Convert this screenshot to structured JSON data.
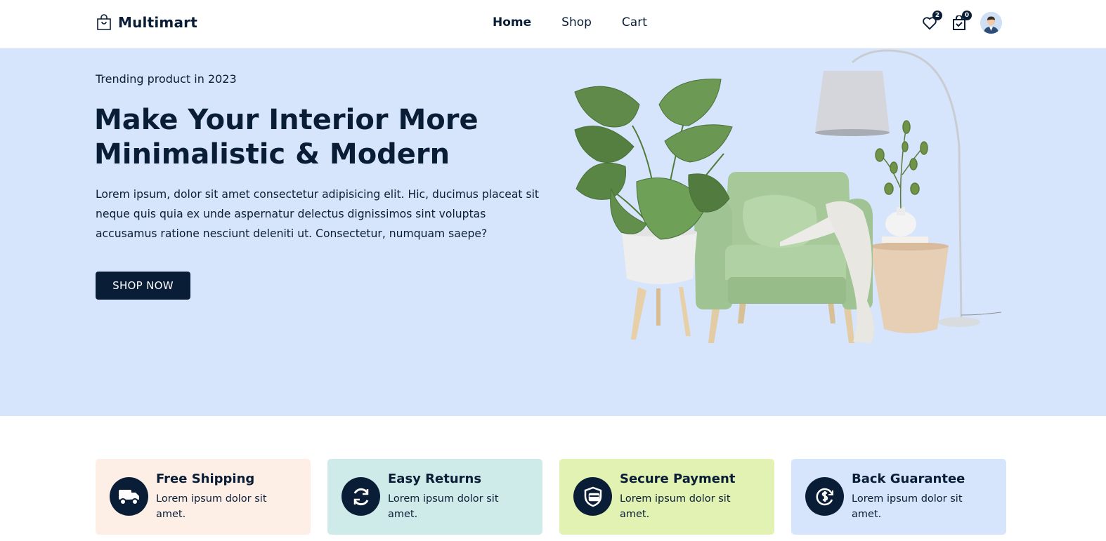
{
  "header": {
    "brand": "Multimart",
    "nav": [
      {
        "label": "Home",
        "active": true
      },
      {
        "label": "Shop",
        "active": false
      },
      {
        "label": "Cart",
        "active": false
      }
    ],
    "wishlist_count": "2",
    "cart_count": "0",
    "icons": {
      "logo": "shopping-bag-icon",
      "wishlist": "heart-icon",
      "cart": "shopping-bag-icon"
    }
  },
  "hero": {
    "subtitle": "Trending product in 2023",
    "title": "Make Your Interior More Minimalistic & Modern",
    "text": "Lorem ipsum, dolor sit amet consectetur adipisicing elit. Hic, ducimus placeat sit neque quis quia ex unde aspernatur delectus dignissimos sint voluptas accusamus ratione nesciunt deleniti ut. Consectetur, numquam saepe?",
    "button": "SHOP NOW",
    "image": "green-armchair-with-plant-lamp-side-table"
  },
  "services": [
    {
      "title": "Free Shipping",
      "text": "Lorem ipsum dolor sit amet.",
      "icon": "truck-icon",
      "bg": "#fdefe6"
    },
    {
      "title": "Easy Returns",
      "text": "Lorem ipsum dolor sit amet.",
      "icon": "refresh-icon",
      "bg": "#ceebe9"
    },
    {
      "title": "Secure Payment",
      "text": "Lorem ipsum dolor sit amet.",
      "icon": "secure-payment-icon",
      "bg": "#e2f2b2"
    },
    {
      "title": "Back Guarantee",
      "text": "Lorem ipsum dolor sit amet.",
      "icon": "money-back-icon",
      "bg": "#d6e5fb"
    }
  ],
  "colors": {
    "primary": "#0a1d37",
    "hero_bg": "#d6e5fb"
  }
}
